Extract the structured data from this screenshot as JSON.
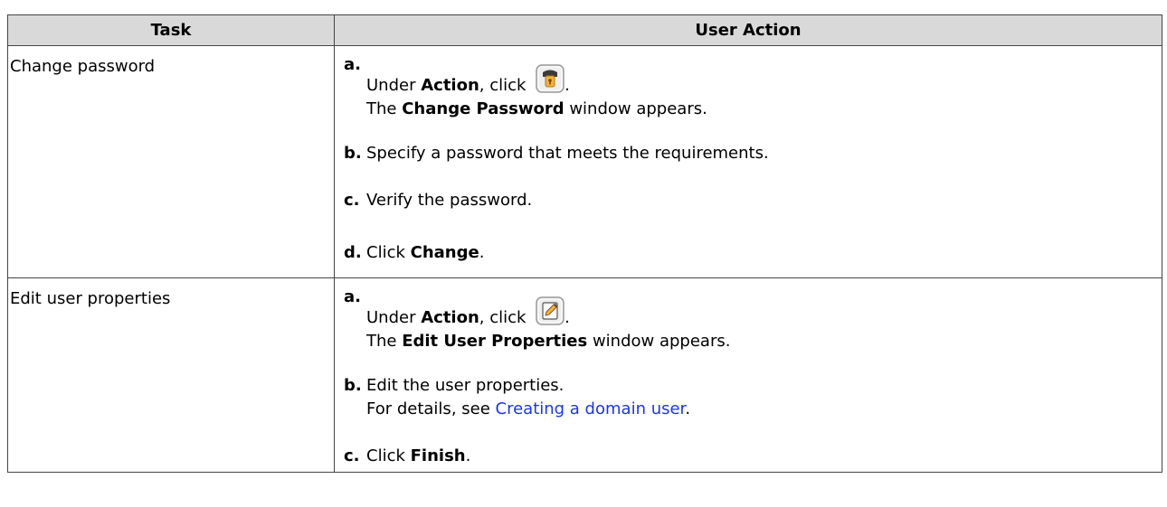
{
  "headers": {
    "task": "Task",
    "user_action": "User Action"
  },
  "rows": [
    {
      "task": "Change password",
      "steps": [
        {
          "letter": "a.",
          "pre": "Under ",
          "bold": "Action",
          "post": ", click ",
          "icon": "lock-key-icon",
          "end": ".",
          "line2_pre": "The ",
          "line2_bold": "Change Password",
          "line2_post": " window appears."
        },
        {
          "letter": "b.",
          "text": "Specify a password that meets the requirements."
        },
        {
          "letter": "c.",
          "text": "Verify the password."
        },
        {
          "letter": "d.",
          "pre": "Click ",
          "bold": "Change",
          "end": "."
        }
      ]
    },
    {
      "task": "Edit user properties",
      "steps": [
        {
          "letter": "a.",
          "pre": "Under ",
          "bold": "Action",
          "post": ", click ",
          "icon": "edit-pencil-icon",
          "end": ".",
          "line2_pre": "The ",
          "line2_bold": "Edit User Properties",
          "line2_post": " window appears."
        },
        {
          "letter": "b.",
          "text": "Edit the user properties.",
          "line2_pre": "For details, see ",
          "line2_link": "Creating a domain user",
          "line2_post": "."
        },
        {
          "letter": "c.",
          "pre": "Click ",
          "bold": "Finish",
          "end": "."
        }
      ]
    }
  ],
  "colors": {
    "header_bg": "#d9d9d9",
    "link": "#1a35f0",
    "border": "#444444"
  }
}
